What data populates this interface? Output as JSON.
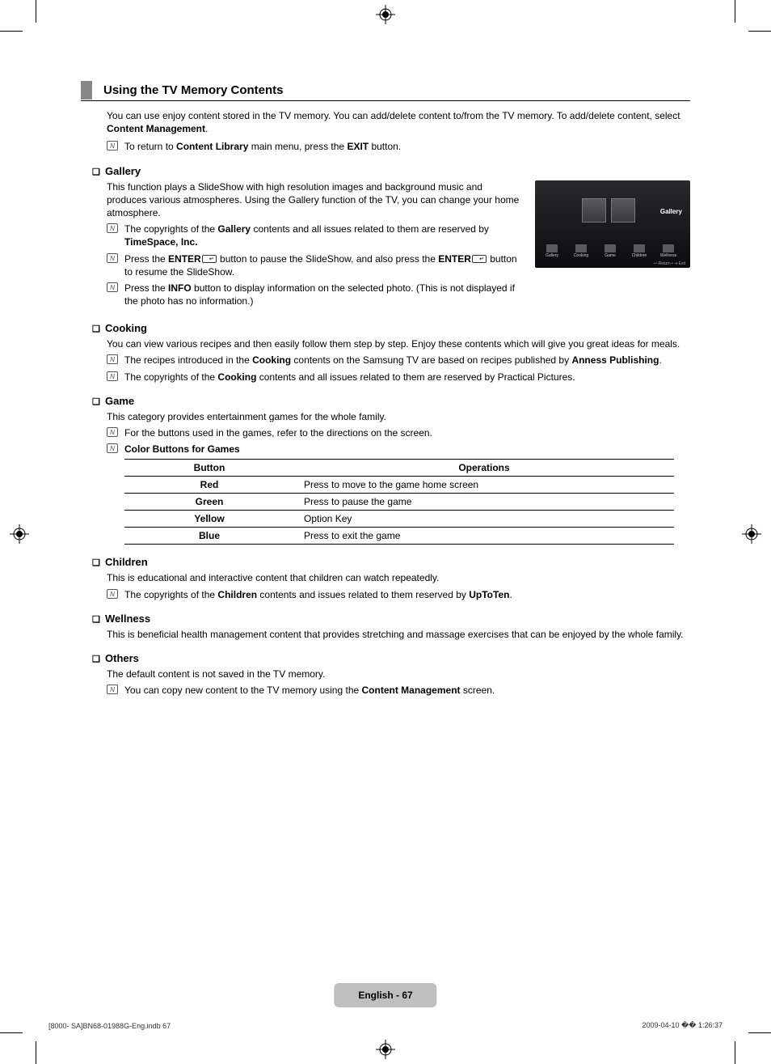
{
  "heading": "Using the TV Memory Contents",
  "intro_parts": [
    "You can use enjoy content stored in the TV memory. You can add/delete content to/from the TV memory. To add/delete content, select ",
    "Content Management",
    "."
  ],
  "intro_note": [
    "To return to ",
    "Content Library",
    " main menu, press the ",
    "EXIT",
    " button."
  ],
  "gallery": {
    "title": "Gallery",
    "body": "This function plays a SlideShow with high resolution images and background music and produces various atmospheres. Using the Gallery function of the TV, you can change your home atmosphere.",
    "notes": [
      [
        "The copyrights of the ",
        "Gallery",
        " contents and all issues related to them are reserved by ",
        "TimeSpace, Inc."
      ],
      [
        "Press the ",
        "ENTER",
        " button to pause the SlideShow, and also press the ",
        "ENTER",
        " button to resume the SlideShow."
      ],
      [
        "Press the ",
        "INFO",
        " button to display information on the selected photo. (This is not displayed if the photo has no information.)"
      ]
    ],
    "panel_label": "Gallery",
    "icons": [
      "Gallery",
      "Cooking",
      "Game",
      "Children",
      "Wellness"
    ],
    "foot": "↩ Return   • ⇥ Exit"
  },
  "cooking": {
    "title": "Cooking",
    "body": "You can view various recipes and then easily follow them step by step. Enjoy these contents which will give you great ideas for meals.",
    "notes": [
      [
        "The recipes introduced in the ",
        "Cooking",
        " contents on the Samsung TV are based on recipes published by ",
        "Anness Publishing",
        "."
      ],
      [
        "The copyrights of the ",
        "Cooking",
        " contents and all issues related to them are reserved by Practical Pictures."
      ]
    ]
  },
  "game": {
    "title": "Game",
    "body": "This category provides entertainment games for the whole family.",
    "note1": "For the buttons used in the games, refer to the directions on the screen.",
    "note2": "Color Buttons for Games",
    "table": {
      "headers": [
        "Button",
        "Operations"
      ],
      "rows": [
        [
          "Red",
          "Press to move to the game home screen"
        ],
        [
          "Green",
          "Press to pause the game"
        ],
        [
          "Yellow",
          "Option Key"
        ],
        [
          "Blue",
          "Press to exit the game"
        ]
      ]
    }
  },
  "children": {
    "title": "Children",
    "body": "This is educational and interactive content that children can watch repeatedly.",
    "note": [
      "The copyrights of the ",
      "Children",
      " contents and issues related to them reserved by ",
      "UpToTen",
      "."
    ]
  },
  "wellness": {
    "title": "Wellness",
    "body": "This is beneficial health management content that provides stretching and massage exercises that can be enjoyed by the whole family."
  },
  "others": {
    "title": "Others",
    "body": "The default content is not saved in the TV memory.",
    "note": [
      "You can copy new content to the TV memory using the ",
      "Content Management",
      " screen."
    ]
  },
  "footer_page": "English - 67",
  "printline_left": "[8000- SA]BN68-01988G-Eng.indb   67",
  "printline_right": "2009-04-10   �� 1:26:37"
}
